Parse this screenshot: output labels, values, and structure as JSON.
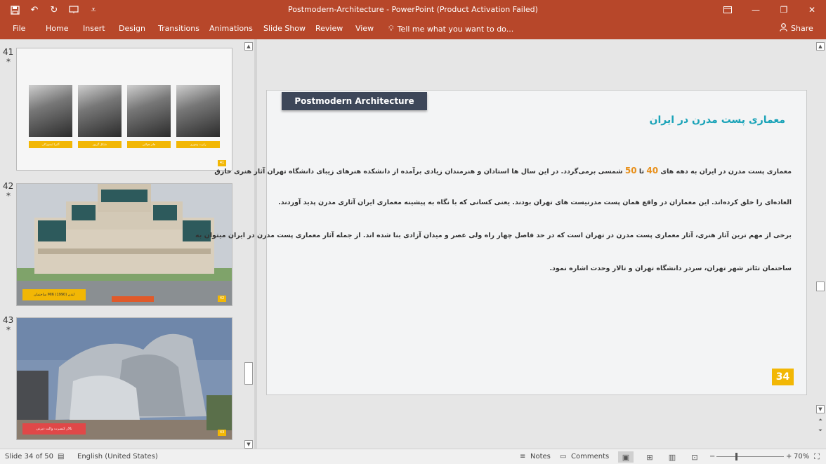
{
  "window": {
    "title": "Postmodern-Architecture - PowerPoint (Product Activation Failed)"
  },
  "ribbon": {
    "tabs": [
      "File",
      "Home",
      "Insert",
      "Design",
      "Transitions",
      "Animations",
      "Slide Show",
      "Review",
      "View"
    ],
    "tell_me": "Tell me what you want to do...",
    "share": "Share"
  },
  "thumbnails": [
    {
      "number": "41",
      "star": "*",
      "page": "41",
      "labels": [
        "آکیرا ایسوزاکی",
        "مایکل گریوز",
        "هانز هولاین",
        "رابرت ونتوری"
      ]
    },
    {
      "number": "42",
      "star": "*",
      "page": "42",
      "caption": "ساختمان MI6 لندن (1990)"
    },
    {
      "number": "43",
      "star": "*",
      "page": "43",
      "caption": "تالار کنسرت والت دیزنی"
    }
  ],
  "slide": {
    "tab_title": "Postmodern Architecture",
    "heading": "معماری پست مدرن در ایران",
    "para1_a": "معماری پست مدرن در ایران به دهه های ",
    "para1_n1": "40",
    "para1_b": " تا ",
    "para1_n2": "50",
    "para1_c": " شمسی برمی‌گردد. در این سال ها استادان و هنرمندان زیادی برآمده از دانشکده هنرهای زیبای دانشگاه تهران آثار هنری خارق",
    "para2": "العاده‌ای را خلق کرده‌اند. این معماران در واقع همان پست مدرنیست های تهران بودند. یعنی کسانی که با نگاه به پیشینه معماری ایران آثاری مدرن پدید آوردند.",
    "para3": "برخی از مهم ترین آثار هنری، آثار معماری پست مدرن در تهران است که در حد فاصل چهار راه ولی عصر و میدان آزادی بنا شده اند. از جمله آثار معماری پست مدرن در ایران میتوان به",
    "para4": "ساختمان تئاتر شهر تهران، سردر دانشگاه تهران و تالار وحدت اشاره نمود.",
    "number": "34"
  },
  "status": {
    "slide_info": "Slide 34 of 50",
    "language": "English (United States)",
    "notes": "Notes",
    "comments": "Comments",
    "zoom": "70%",
    "zoom_value": 0.7
  },
  "colors": {
    "accent": "#b7472a",
    "slide_heading": "#1aa3b8",
    "highlight_number": "#e8901b",
    "slide_number_bg": "#f2b705",
    "title_tab_bg": "#3d4759"
  },
  "icons": [
    "save-icon",
    "undo-icon",
    "redo-icon",
    "slideshow-icon",
    "customize-icon",
    "ribbon-display-icon",
    "minimize-icon",
    "restore-icon",
    "close-icon",
    "lightbulb-icon",
    "user-icon",
    "notes-icon",
    "comments-icon",
    "normal-view-icon",
    "slide-sorter-icon",
    "reading-view-icon",
    "slideshow-view-icon",
    "fit-window-icon"
  ]
}
